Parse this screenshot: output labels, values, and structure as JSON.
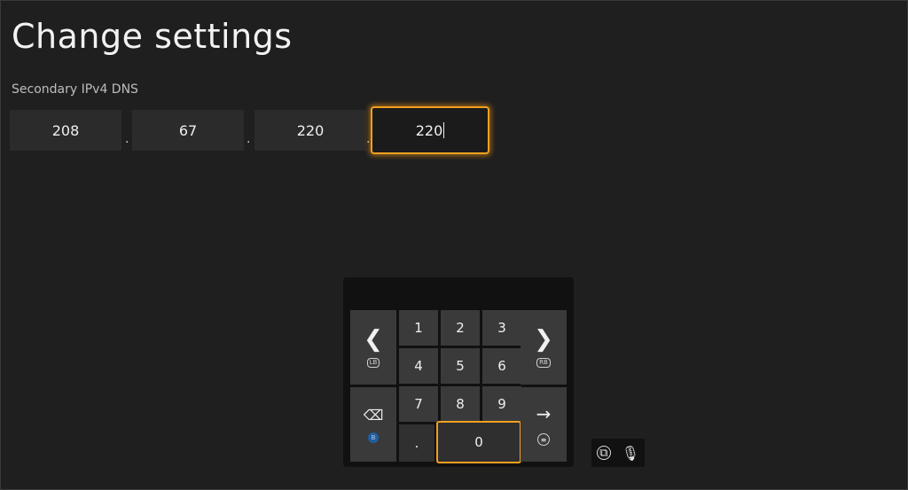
{
  "page": {
    "title": "Change settings"
  },
  "dns": {
    "label": "Secondary IPv4 DNS",
    "octets": [
      "208",
      "67",
      "220",
      "220"
    ],
    "separator": "."
  },
  "keypad": {
    "keys": [
      "1",
      "2",
      "3",
      "4",
      "5",
      "6",
      "7",
      "8",
      "9",
      "0",
      "."
    ],
    "left_badge": "LB",
    "right_badge": "RB"
  },
  "colors": {
    "accent": "#f0a020",
    "background": "#1e1e1e"
  },
  "icons": [
    "chevron-left-icon",
    "chevron-right-icon",
    "backspace-icon",
    "arrow-right-icon",
    "menu-icon",
    "b-button-icon",
    "view-icon",
    "microphone-icon"
  ]
}
